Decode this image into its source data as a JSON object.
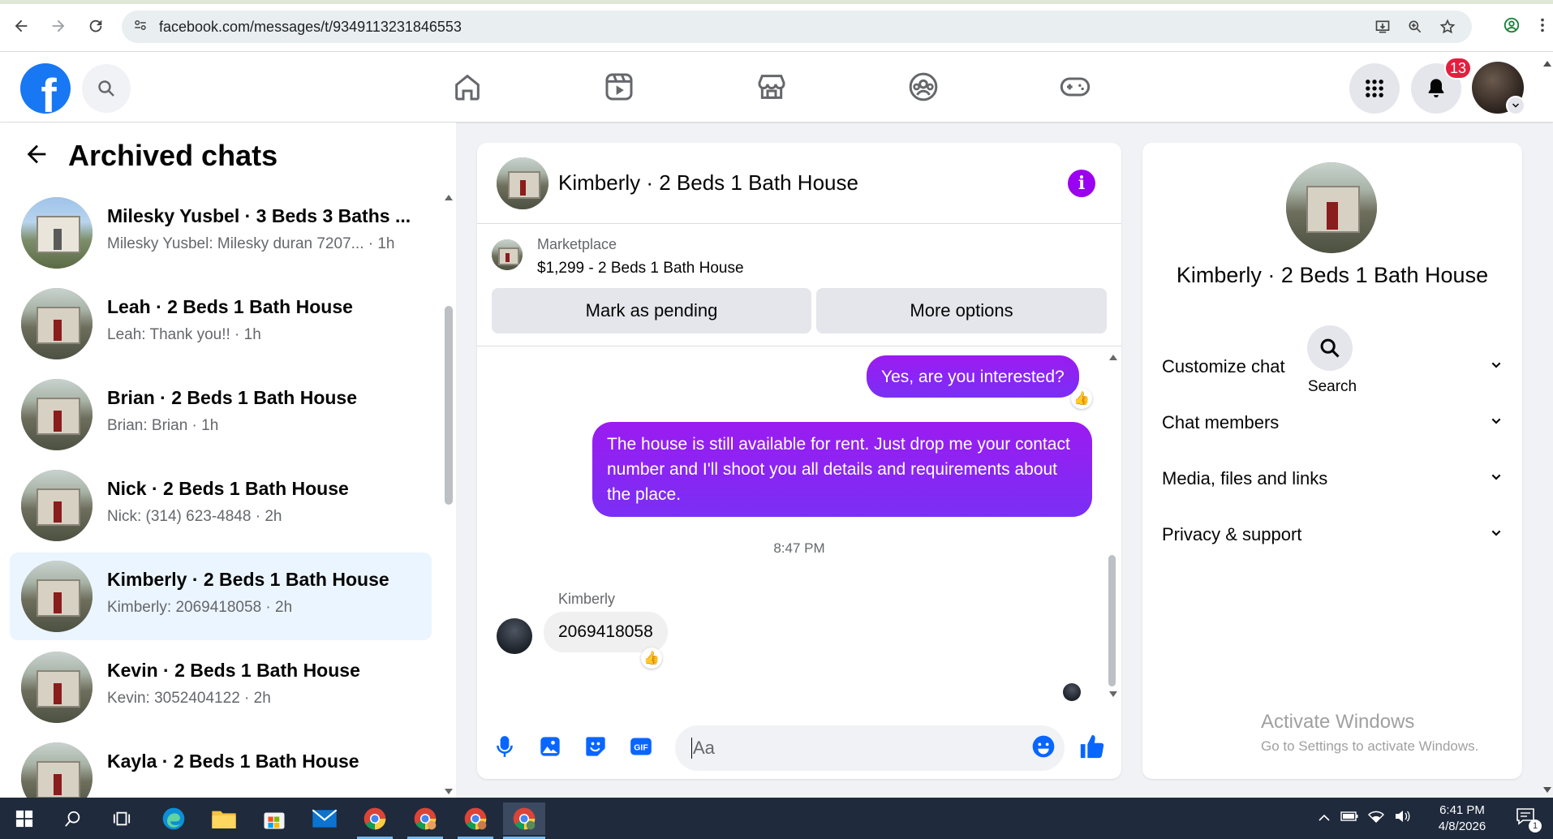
{
  "browser": {
    "url": "facebook.com/messages/t/9349113231846553"
  },
  "header": {
    "notification_count": "13"
  },
  "left_panel": {
    "title": "Archived chats",
    "chats": [
      {
        "name": "Milesky Yusbel · 3 Beds 3 Baths ...",
        "preview": "Milesky Yusbel: Milesky duran 7207... · 1h",
        "active": false
      },
      {
        "name": "Leah · 2 Beds 1 Bath House",
        "preview": "Leah: Thank you!! · 1h",
        "active": false
      },
      {
        "name": "Brian · 2 Beds 1 Bath House",
        "preview": "Brian: Brian · 1h",
        "active": false
      },
      {
        "name": "Nick · 2 Beds 1 Bath House",
        "preview": "Nick: (314) 623-4848 · 2h",
        "active": false
      },
      {
        "name": "Kimberly · 2 Beds 1 Bath House",
        "preview": "Kimberly: 2069418058 · 2h",
        "active": true
      },
      {
        "name": "Kevin · 2 Beds 1 Bath House",
        "preview": "Kevin: 3052404122 · 2h",
        "active": false
      },
      {
        "name": "Kayla · 2 Beds 1 Bath House",
        "preview": "",
        "active": false
      }
    ]
  },
  "chat": {
    "title": "Kimberly · 2 Beds 1 Bath House",
    "marketplace_label": "Marketplace",
    "listing": "$1,299 - 2 Beds 1 Bath House",
    "mark_pending_label": "Mark as pending",
    "more_options_label": "More options",
    "messages": [
      {
        "from": "me",
        "text": "Yes, are you interested?"
      },
      {
        "from": "me",
        "text": "The house is still available for rent. Just drop me your contact number and I'll shoot you all details and requirements about the place."
      },
      {
        "from": "them",
        "sender": "Kimberly",
        "text": "2069418058"
      }
    ],
    "timestamp": "8:47 PM",
    "composer_placeholder": "Aa",
    "accent_color": "#9b00f0"
  },
  "right_panel": {
    "title": "Kimberly · 2 Beds 1 Bath House",
    "search_label": "Search",
    "sections": [
      {
        "label": "Customize chat"
      },
      {
        "label": "Chat members"
      },
      {
        "label": "Media, files and links"
      },
      {
        "label": "Privacy & support"
      }
    ],
    "watermark_title": "Activate Windows",
    "watermark_sub": "Go to Settings to activate Windows."
  },
  "taskbar": {
    "time": "6:41 PM",
    "date": "4/8/2026",
    "notification_count": "1"
  }
}
